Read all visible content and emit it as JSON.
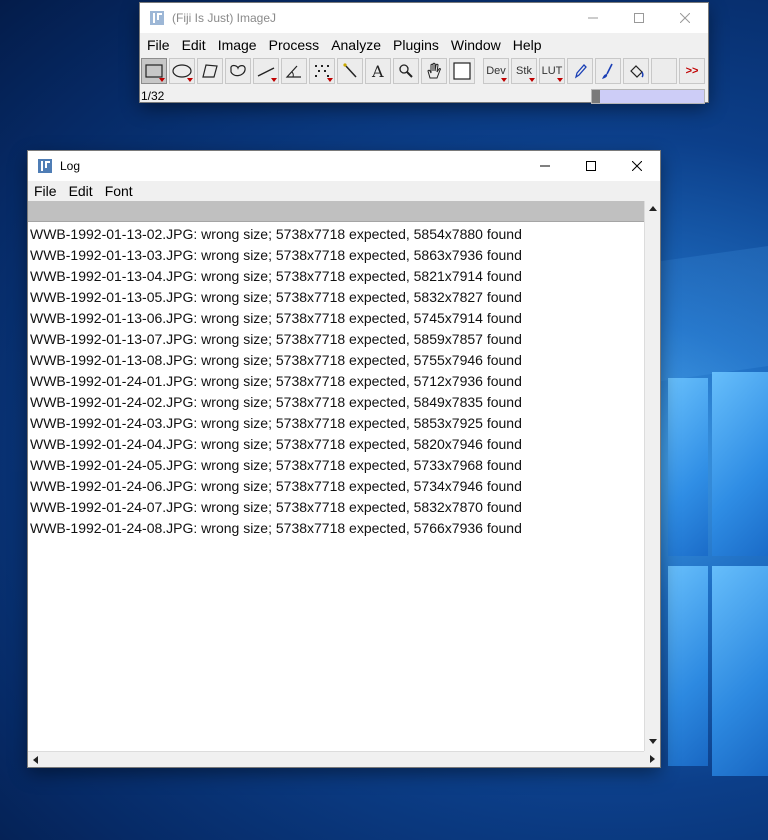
{
  "imagej": {
    "title": "(Fiji Is Just) ImageJ",
    "menu": [
      "File",
      "Edit",
      "Image",
      "Process",
      "Analyze",
      "Plugins",
      "Window",
      "Help"
    ],
    "tools": {
      "dev": "Dev",
      "stk": "Stk",
      "lut": "LUT",
      "more": ">>"
    },
    "status": "1/32",
    "progress": 0.07
  },
  "log": {
    "title": "Log",
    "menu": [
      "File",
      "Edit",
      "Font"
    ],
    "lines": [
      "WWB-1992-01-13-02.JPG: wrong size; 5738x7718 expected, 5854x7880 found",
      "WWB-1992-01-13-03.JPG: wrong size; 5738x7718 expected, 5863x7936 found",
      "WWB-1992-01-13-04.JPG: wrong size; 5738x7718 expected, 5821x7914 found",
      "WWB-1992-01-13-05.JPG: wrong size; 5738x7718 expected, 5832x7827 found",
      "WWB-1992-01-13-06.JPG: wrong size; 5738x7718 expected, 5745x7914 found",
      "WWB-1992-01-13-07.JPG: wrong size; 5738x7718 expected, 5859x7857 found",
      "WWB-1992-01-13-08.JPG: wrong size; 5738x7718 expected, 5755x7946 found",
      "WWB-1992-01-24-01.JPG: wrong size; 5738x7718 expected, 5712x7936 found",
      "WWB-1992-01-24-02.JPG: wrong size; 5738x7718 expected, 5849x7835 found",
      "WWB-1992-01-24-03.JPG: wrong size; 5738x7718 expected, 5853x7925 found",
      "WWB-1992-01-24-04.JPG: wrong size; 5738x7718 expected, 5820x7946 found",
      "WWB-1992-01-24-05.JPG: wrong size; 5738x7718 expected, 5733x7968 found",
      "WWB-1992-01-24-06.JPG: wrong size; 5738x7718 expected, 5734x7946 found",
      "WWB-1992-01-24-07.JPG: wrong size; 5738x7718 expected, 5832x7870 found",
      "WWB-1992-01-24-08.JPG: wrong size; 5738x7718 expected, 5766x7936 found"
    ]
  },
  "colors": {
    "desktop": "#0c3f8a",
    "progress_track": "#cdcdf7",
    "tool_indicator": "#c00000"
  }
}
